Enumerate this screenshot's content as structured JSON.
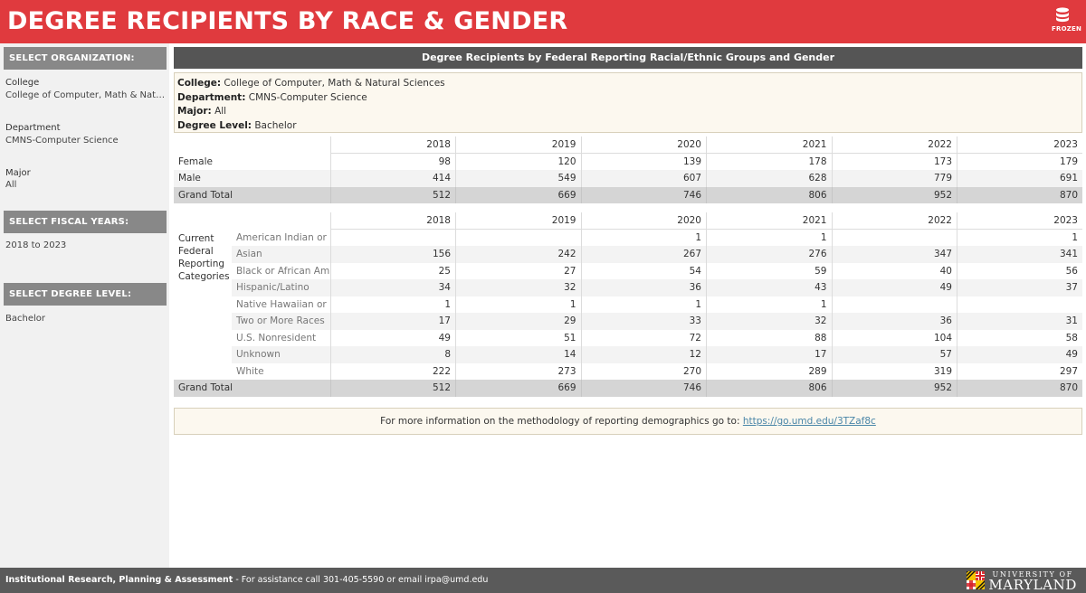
{
  "header": {
    "title": "DEGREE RECIPIENTS BY RACE & GENDER",
    "frozen_label": "FROZEN"
  },
  "sidebar": {
    "org_heading": "SELECT ORGANIZATION:",
    "college_label": "College",
    "college_value": "College of Computer, Math & Natur..",
    "department_label": "Department",
    "department_value": "CMNS-Computer Science",
    "major_label": "Major",
    "major_value": "All",
    "fiscal_heading": "SELECT FISCAL YEARS:",
    "fiscal_value": "2018 to 2023",
    "degree_heading": "SELECT DEGREE LEVEL:",
    "degree_value": "Bachelor"
  },
  "panel": {
    "title": "Degree Recipients by Federal Reporting Racial/Ethnic Groups and Gender",
    "info": {
      "college_key": "College:",
      "college_val": " College of Computer, Math & Natural Sciences",
      "department_key": "Department:",
      "department_val": " CMNS-Computer Science",
      "major_key": "Major:",
      "major_val": " All",
      "degree_key": "Degree Level:",
      "degree_val": " Bachelor"
    }
  },
  "gender_table": {
    "years": [
      "2018",
      "2019",
      "2020",
      "2021",
      "2022",
      "2023"
    ],
    "rows": [
      {
        "label": "Female",
        "values": [
          "98",
          "120",
          "139",
          "178",
          "173",
          "179"
        ]
      },
      {
        "label": "Male",
        "values": [
          "414",
          "549",
          "607",
          "628",
          "779",
          "691"
        ]
      }
    ],
    "total": {
      "label": "Grand Total",
      "values": [
        "512",
        "669",
        "746",
        "806",
        "952",
        "870"
      ]
    }
  },
  "race_table": {
    "years": [
      "2018",
      "2019",
      "2020",
      "2021",
      "2022",
      "2023"
    ],
    "group_label": "Current Federal Reporting Categories",
    "rows": [
      {
        "label": "American Indian or ..",
        "values": [
          "",
          "",
          "1",
          "1",
          "",
          "1"
        ]
      },
      {
        "label": "Asian",
        "values": [
          "156",
          "242",
          "267",
          "276",
          "347",
          "341"
        ]
      },
      {
        "label": "Black or African Am..",
        "values": [
          "25",
          "27",
          "54",
          "59",
          "40",
          "56"
        ]
      },
      {
        "label": "Hispanic/Latino",
        "values": [
          "34",
          "32",
          "36",
          "43",
          "49",
          "37"
        ]
      },
      {
        "label": "Native Hawaiian or ..",
        "values": [
          "1",
          "1",
          "1",
          "1",
          "",
          ""
        ]
      },
      {
        "label": "Two or More Races",
        "values": [
          "17",
          "29",
          "33",
          "32",
          "36",
          "31"
        ]
      },
      {
        "label": "U.S. Nonresident",
        "values": [
          "49",
          "51",
          "72",
          "88",
          "104",
          "58"
        ]
      },
      {
        "label": "Unknown",
        "values": [
          "8",
          "14",
          "12",
          "17",
          "57",
          "49"
        ]
      },
      {
        "label": "White",
        "values": [
          "222",
          "273",
          "270",
          "289",
          "319",
          "297"
        ]
      }
    ],
    "total": {
      "label": "Grand Total",
      "values": [
        "512",
        "669",
        "746",
        "806",
        "952",
        "870"
      ]
    }
  },
  "footnote": {
    "text": "For more information on the methodology of reporting demographics go to: ",
    "link": "https://go.umd.edu/3TZaf8c"
  },
  "footer": {
    "org": "Institutional Research, Planning & Assessment",
    "assist": " - For assistance call 301-405-5590 or email irpa@umd.edu",
    "logo_line1": "UNIVERSITY OF",
    "logo_line2": "MARYLAND"
  },
  "colors": {
    "header_red": "#e03a3e",
    "panel_gray": "#555555",
    "footer_gray": "#5a5a5a",
    "info_bg": "#fcf8ef",
    "link": "#4a86a8"
  }
}
